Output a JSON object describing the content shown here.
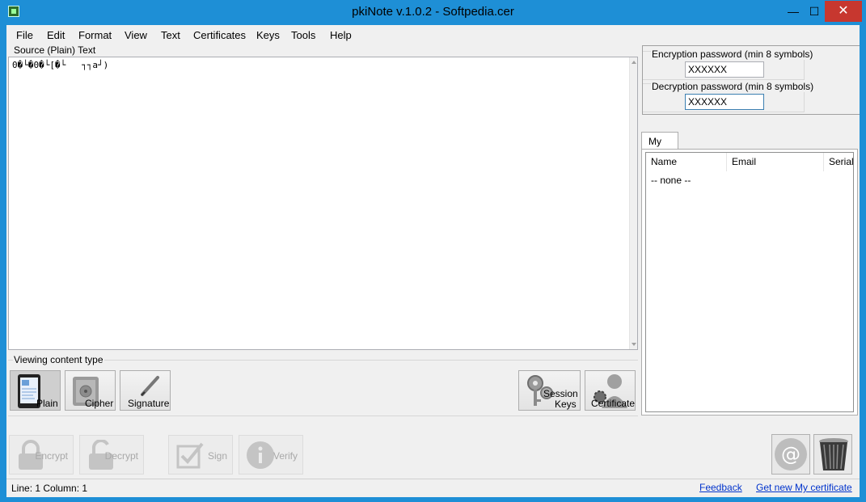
{
  "window": {
    "title": "pkiNote  v.1.0.2 - Softpedia.cer",
    "min_glyph": "—",
    "max_glyph": "☐",
    "close_glyph": "✕"
  },
  "menu": [
    "File",
    "Edit",
    "Format",
    "View",
    "Text",
    "Certificates",
    "Keys",
    "Tools",
    "Help"
  ],
  "source": {
    "label": "Source (Plain) Text",
    "content": "0�└�0�└[�└   ┐┐a┘)"
  },
  "viewing": {
    "label": "Viewing content type",
    "plain": "Plain",
    "cipher": "Cipher",
    "signature": "Signature",
    "session_keys_line1": "Session",
    "session_keys_line2": "Keys",
    "certificate": "Certificate"
  },
  "actions": {
    "encrypt": "Encrypt",
    "decrypt": "Decrypt",
    "sign": "Sign",
    "verify": "Verify"
  },
  "passwords": {
    "encryption_label": "Encryption password (min 8 symbols)",
    "encryption_value": "XXXXXX",
    "decryption_label": "Decryption password (min 8 symbols)",
    "decryption_value": "XXXXXX"
  },
  "certs": {
    "tab": "My",
    "columns": [
      "Name",
      "Email",
      "Serial N"
    ],
    "empty_row": "-- none --"
  },
  "status": {
    "position": "Line: 1  Column: 1",
    "feedback": "Feedback",
    "get_cert": "Get new My certificate"
  },
  "colors": {
    "titlebar": "#1e8fd6",
    "close": "#c7372f",
    "link": "#0033cc"
  }
}
